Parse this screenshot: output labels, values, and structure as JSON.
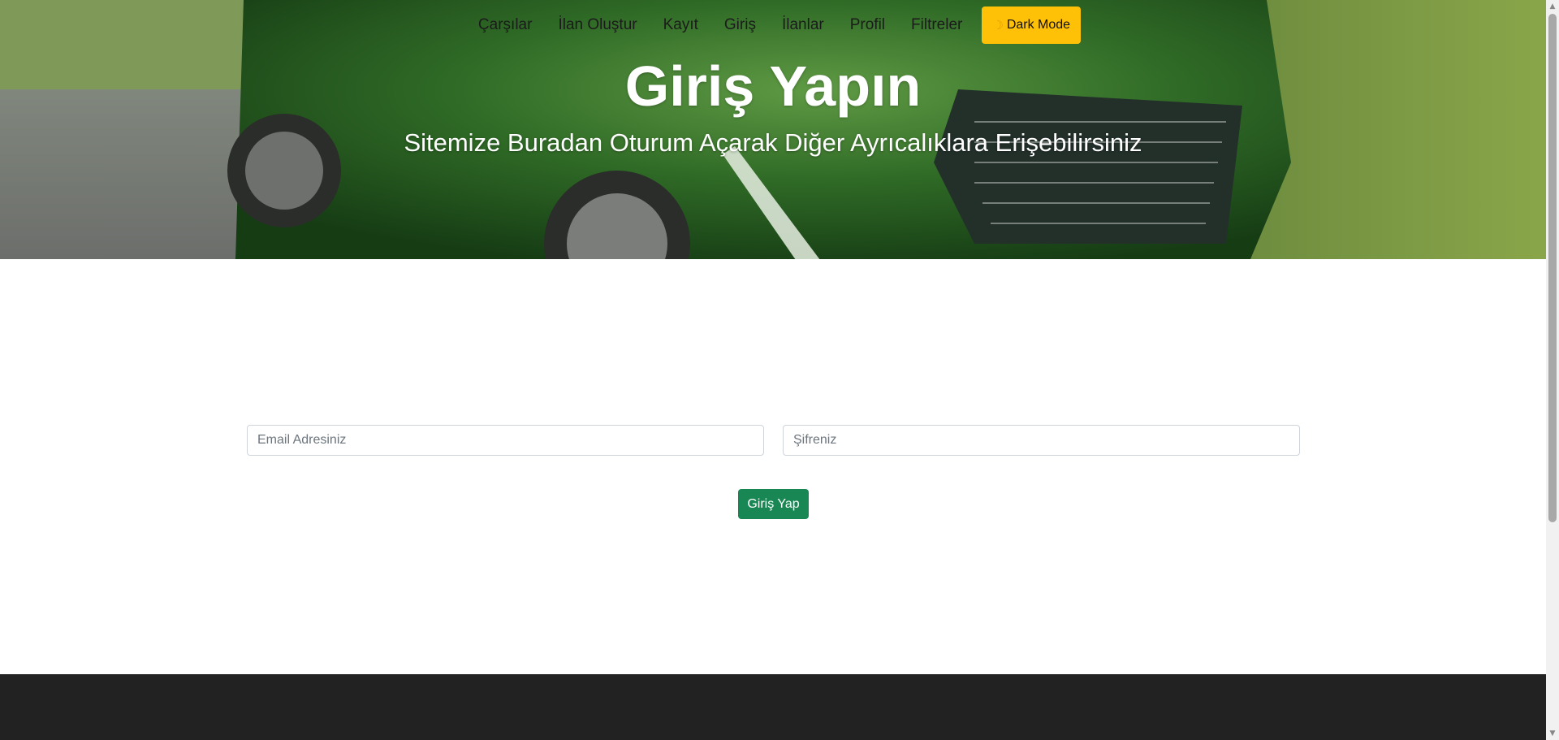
{
  "nav": {
    "items": [
      "Çarşılar",
      "İlan Oluştur",
      "Kayıt",
      "Giriş",
      "İlanlar",
      "Profil",
      "Filtreler"
    ],
    "dark_mode_label": "Dark Mode",
    "dark_mode_icon": "moon-icon"
  },
  "hero": {
    "title": "Giriş Yapın",
    "subtitle": "Sitemize Buradan Oturum Açarak Diğer Ayrıcalıklara Erişebilirsiniz"
  },
  "form": {
    "email_placeholder": "Email Adresiniz",
    "password_placeholder": "Şifreniz",
    "submit_label": "Giriş Yap"
  },
  "colors": {
    "accent_warning": "#ffc107",
    "success": "#198754",
    "footer": "#222222"
  }
}
